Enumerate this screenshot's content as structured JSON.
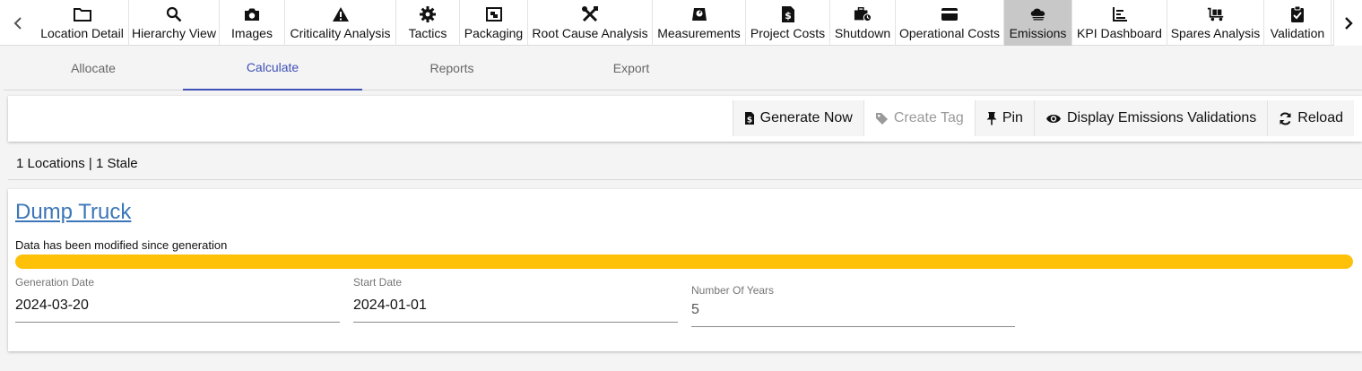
{
  "toolbar": {
    "items": [
      {
        "label": "Location Detail",
        "icon": "folder-icon"
      },
      {
        "label": "Hierarchy View",
        "icon": "search-icon"
      },
      {
        "label": "Images",
        "icon": "camera-icon"
      },
      {
        "label": "Criticality Analysis",
        "icon": "warning-icon"
      },
      {
        "label": "Tactics",
        "icon": "gear-icon"
      },
      {
        "label": "Packaging",
        "icon": "package-icon"
      },
      {
        "label": "Root Cause Analysis",
        "icon": "tools-icon"
      },
      {
        "label": "Measurements",
        "icon": "scale-icon"
      },
      {
        "label": "Project Costs",
        "icon": "dollar-file-icon"
      },
      {
        "label": "Shutdown",
        "icon": "briefcase-clock-icon"
      },
      {
        "label": "Operational Costs",
        "icon": "credit-card-icon"
      },
      {
        "label": "Emissions",
        "icon": "cloud-emissions-icon",
        "active": true
      },
      {
        "label": "KPI Dashboard",
        "icon": "bar-chart-icon"
      },
      {
        "label": "Spares Analysis",
        "icon": "cart-icon"
      },
      {
        "label": "Validation",
        "icon": "clipboard-check-icon"
      }
    ]
  },
  "subtabs": [
    {
      "label": "Allocate"
    },
    {
      "label": "Calculate",
      "active": true
    },
    {
      "label": "Reports"
    },
    {
      "label": "Export"
    }
  ],
  "actions": {
    "generate_now": "Generate Now",
    "create_tag": "Create Tag",
    "pin": "Pin",
    "display_validations": "Display Emissions Validations",
    "reload": "Reload"
  },
  "summary": "1 Locations | 1 Stale",
  "card": {
    "title": "Dump Truck",
    "status_message": "Data has been modified since generation",
    "progress_percent": 100,
    "progress_color": "#ffc107",
    "fields": {
      "generation_date": {
        "label": "Generation Date",
        "value": "2024-03-20"
      },
      "start_date": {
        "label": "Start Date",
        "value": "2024-01-01"
      },
      "number_of_years": {
        "label": "Number Of Years",
        "value": "5"
      }
    }
  },
  "colors": {
    "accent": "#3f51b5",
    "link": "#3b76b8",
    "active_tool_bg": "#c8c8c8"
  }
}
